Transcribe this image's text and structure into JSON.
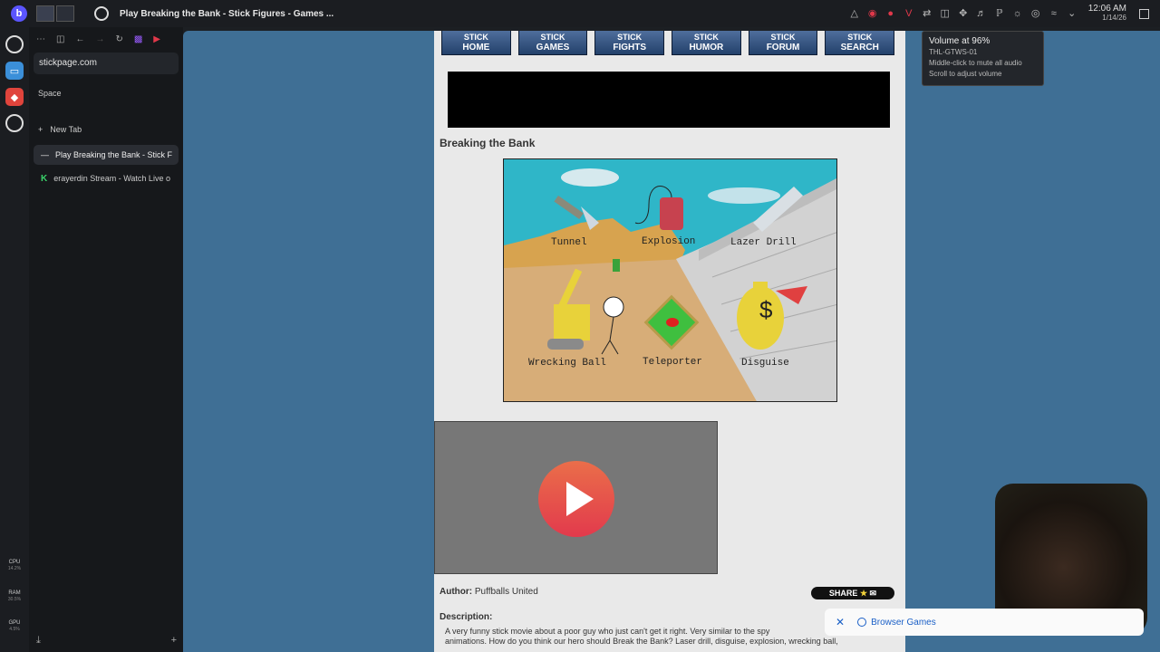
{
  "titlebar": {
    "window_title": "Play Breaking the Bank - Stick Figures - Games ...",
    "clock_time": "12:06 AM",
    "clock_date": "1/14/26"
  },
  "rail": {
    "stats": [
      {
        "label": "CPU",
        "value": "14.2%"
      },
      {
        "label": "RAM",
        "value": "30.5%"
      },
      {
        "label": "GPU",
        "value": "4.5%"
      }
    ]
  },
  "sidebar": {
    "address": "stickpage.com",
    "space_label": "Space",
    "new_tab_label": "New Tab",
    "tabs": [
      {
        "label": "Play Breaking the Bank - Stick F",
        "active": true
      },
      {
        "label": "erayerdin Stream - Watch Live o",
        "active": false
      }
    ]
  },
  "nav": {
    "buttons": [
      {
        "top": "STICK",
        "label": "HOME"
      },
      {
        "top": "STICK",
        "label": "GAMES"
      },
      {
        "top": "STICK",
        "label": "FIGHTS"
      },
      {
        "top": "STICK",
        "label": "HUMOR"
      },
      {
        "top": "STICK",
        "label": "FORUM"
      },
      {
        "top": "STICK",
        "label": "SEARCH"
      }
    ]
  },
  "page": {
    "game_title": "Breaking the Bank",
    "game_options": [
      "Tunnel",
      "Explosion",
      "Lazer Drill",
      "Wrecking Ball",
      "Teleporter",
      "Disguise"
    ],
    "author_label": "Author:",
    "author_name": "Puffballs United",
    "share_label": "SHARE",
    "description_label": "Description:",
    "description_line1": "A very funny stick movie about a poor guy who just can't get it right. Very similar to the spy",
    "description_line2": "animations. How do you think our hero should Break the Bank? Laser drill, disguise, explosion, wrecking ball,"
  },
  "tooltip": {
    "title": "Volume at 96%",
    "device": "THL-GTWS-01",
    "hint1": "Middle-click to mute all audio",
    "hint2": "Scroll to adjust volume"
  },
  "toast": {
    "label": "Browser Games"
  },
  "colors": {
    "viewport_bg": "#3f6f95",
    "content_bg": "#e9e9e9",
    "play_button": "#e2504a",
    "accent_link": "#1a5fc7"
  }
}
